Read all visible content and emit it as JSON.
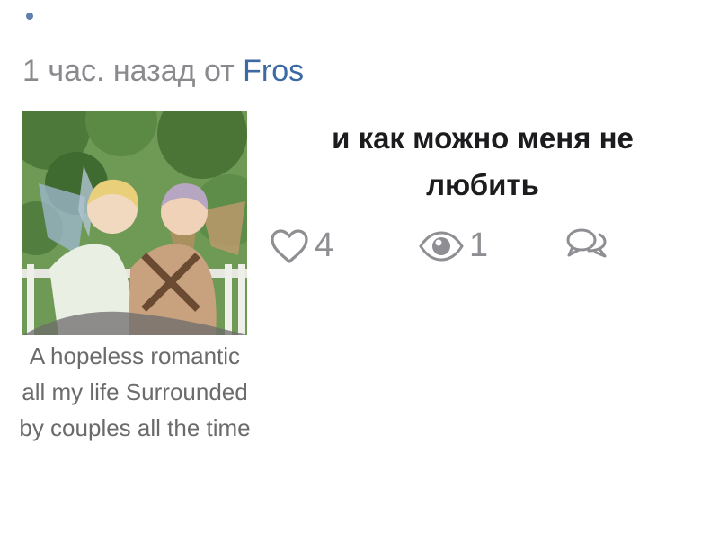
{
  "post": {
    "time_prefix": "1 час. назад от",
    "author": "Fros",
    "title": "и как можно меня не любить",
    "caption": "A hopeless romantic all my life Surrounded by couples all the time",
    "stats": {
      "likes": "4",
      "views": "1"
    },
    "icons": {
      "likes": "heart-icon",
      "views": "eye-icon",
      "comments": "comment-bubbles-icon"
    }
  },
  "colors": {
    "accent_link": "#3d6aa3",
    "muted_text": "#8a8a8e",
    "icon_gray": "#8e8e93"
  }
}
